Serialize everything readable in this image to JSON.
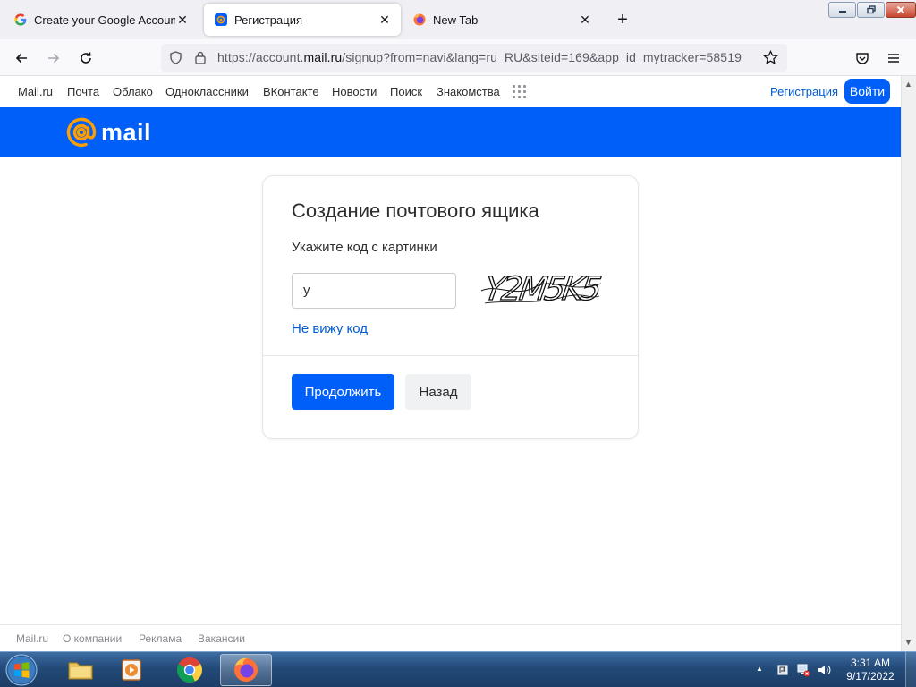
{
  "browser": {
    "tabs": [
      {
        "title": "Create your Google Account",
        "active": false
      },
      {
        "title": "Регистрация",
        "active": true
      },
      {
        "title": "New Tab",
        "active": false
      }
    ],
    "url": {
      "prefix": "https://account.",
      "domain": "mail.ru",
      "path": "/signup?from=navi&lang=ru_RU&siteid=169&app_id_mytracker=58519"
    }
  },
  "portal": {
    "links": [
      "Mail.ru",
      "Почта",
      "Облако",
      "Одноклассники",
      "ВКонтакте",
      "Новости",
      "Поиск",
      "Знакомства"
    ],
    "register_label": "Регистрация",
    "login_label": "Войти"
  },
  "header": {
    "logo_text": "mail"
  },
  "form": {
    "title": "Создание почтового ящика",
    "captcha_label": "Укажите код с картинки",
    "input_value": "у",
    "captcha_text": "Y2M5K5",
    "cant_see_label": "Не вижу код",
    "continue_label": "Продолжить",
    "back_label": "Назад"
  },
  "footer": {
    "links": [
      "Mail.ru",
      "О компании",
      "Реклама",
      "Вакансии"
    ]
  },
  "taskbar": {
    "time": "3:31 AM",
    "date": "9/17/2022"
  },
  "colors": {
    "brand_blue": "#005ff9",
    "link_blue": "#005bd1",
    "logo_orange": "#ff9e00"
  }
}
